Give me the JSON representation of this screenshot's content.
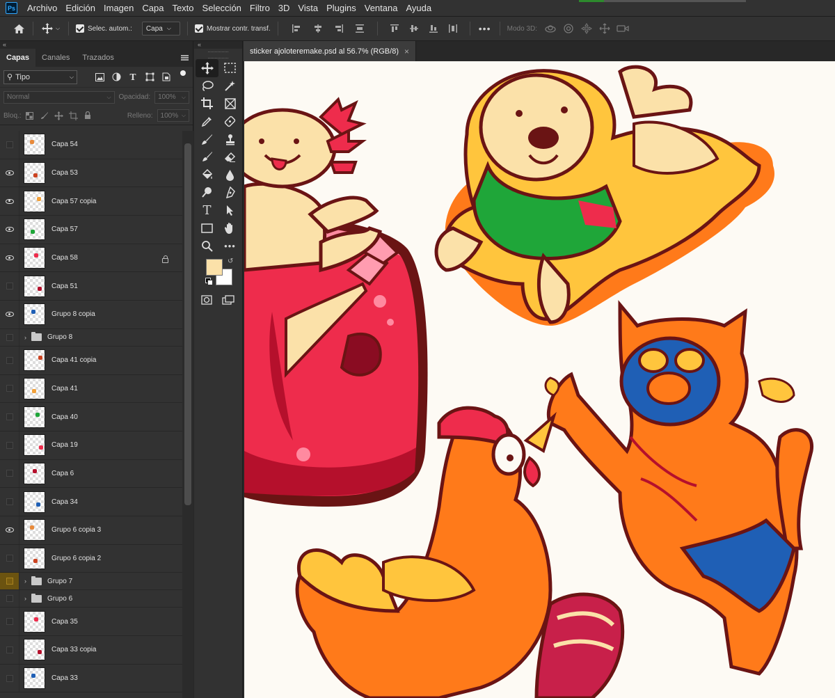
{
  "app": {
    "logo": "Ps"
  },
  "menu": [
    "Archivo",
    "Edición",
    "Imagen",
    "Capa",
    "Texto",
    "Selección",
    "Filtro",
    "3D",
    "Vista",
    "Plugins",
    "Ventana",
    "Ayuda"
  ],
  "options": {
    "auto_select_label": "Selec. autom.:",
    "auto_select_value": "Capa",
    "show_transform_label": "Mostrar contr. transf.",
    "mode3d_label": "Modo 3D:"
  },
  "panel_tabs": [
    "Capas",
    "Canales",
    "Trazados"
  ],
  "layer_filter": {
    "kind": "Tipo"
  },
  "blend": {
    "mode": "Normal",
    "opacity_label": "Opacidad:",
    "opacity": "100%"
  },
  "lock": {
    "label": "Bloq.:",
    "fill_label": "Relleno:",
    "fill": "100%"
  },
  "layers": [
    {
      "name": "Capa 54",
      "visible": false,
      "type": "layer"
    },
    {
      "name": "Capa 53",
      "visible": true,
      "type": "layer"
    },
    {
      "name": "Capa 57 copia",
      "visible": true,
      "type": "layer"
    },
    {
      "name": "Capa 57",
      "visible": true,
      "type": "layer"
    },
    {
      "name": "Capa 58",
      "visible": true,
      "type": "layer",
      "locked": true
    },
    {
      "name": "Capa 51",
      "visible": false,
      "type": "layer"
    },
    {
      "name": "Grupo 8 copia",
      "visible": true,
      "type": "layer"
    },
    {
      "name": "Grupo 8",
      "visible": false,
      "type": "group"
    },
    {
      "name": "Capa 41 copia",
      "visible": false,
      "type": "layer"
    },
    {
      "name": "Capa 41",
      "visible": false,
      "type": "layer"
    },
    {
      "name": "Capa 40",
      "visible": false,
      "type": "layer"
    },
    {
      "name": "Capa 19",
      "visible": false,
      "type": "layer"
    },
    {
      "name": "Capa 6",
      "visible": false,
      "type": "layer"
    },
    {
      "name": "Capa 34",
      "visible": false,
      "type": "layer"
    },
    {
      "name": "Grupo 6 copia 3",
      "visible": true,
      "type": "layer"
    },
    {
      "name": "Grupo 6 copia 2",
      "visible": false,
      "type": "layer"
    },
    {
      "name": "Grupo 7",
      "visible": false,
      "type": "group",
      "highlight": true
    },
    {
      "name": "Grupo 6",
      "visible": false,
      "type": "group"
    },
    {
      "name": "Capa 35",
      "visible": false,
      "type": "layer"
    },
    {
      "name": "Capa 33 copia",
      "visible": false,
      "type": "layer"
    },
    {
      "name": "Capa 33",
      "visible": false,
      "type": "layer"
    }
  ],
  "document": {
    "tab_title": "sticker ajoloteremake.psd al 56.7% (RGB/8)"
  },
  "colors": {
    "foreground": "#fbe1a9",
    "background": "#ffffff",
    "accent_group": "#6b5310"
  }
}
